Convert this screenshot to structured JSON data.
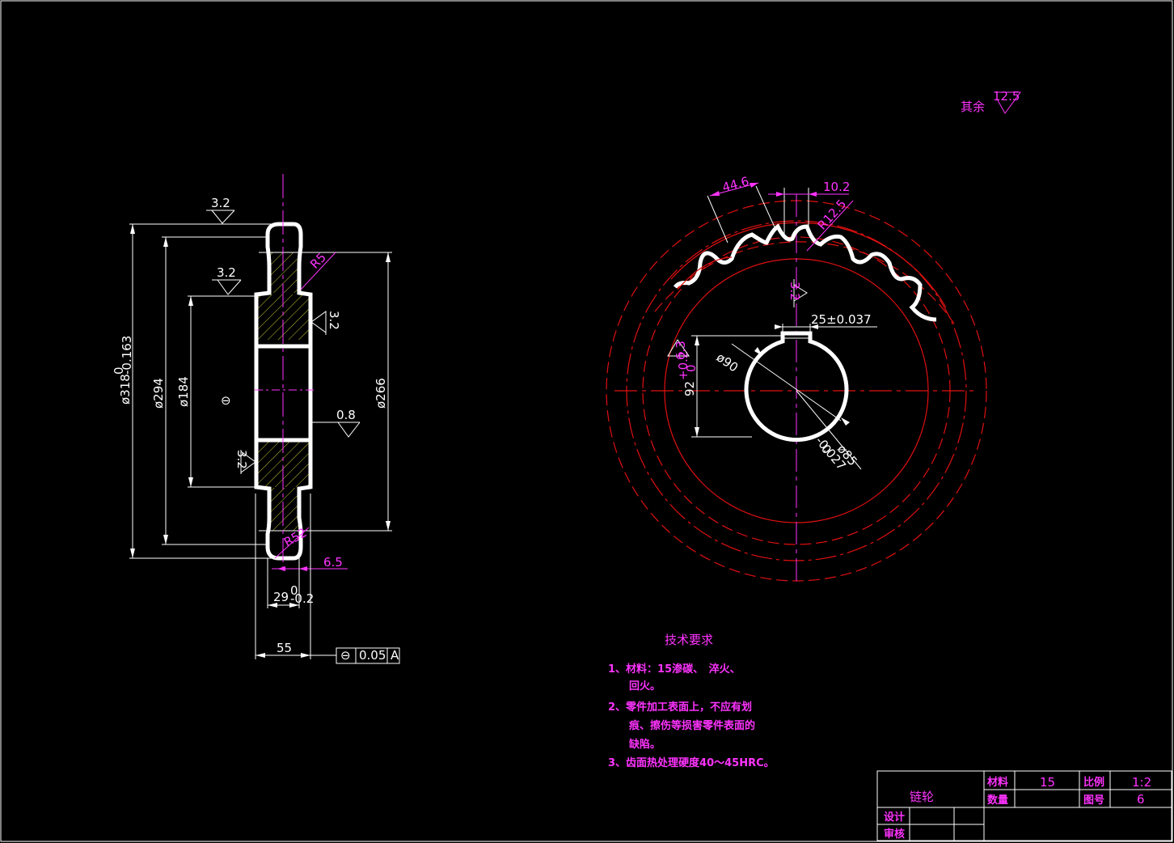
{
  "drawing": {
    "roughness_other": {
      "label": "其余",
      "value": "12.5"
    },
    "side_view": {
      "dimensions": {
        "d318": "ø318",
        "d318_tol_upper": "0",
        "d318_tol_lower": "-0.163",
        "d294": "ø294",
        "d184": "ø184",
        "d266": "ø266",
        "w29": "29",
        "w29_tol_upper": "0",
        "w29_tol_lower": "-0.2",
        "w55": "55",
        "w6_5": "6.5",
        "r5": "R5",
        "r52": "R52"
      },
      "roughness": [
        "3.2",
        "3.2",
        "3.2",
        "0.8",
        "3.2"
      ],
      "flatness_symbol": "⊖",
      "tolerance_frame": {
        "symbol": "⊖",
        "value": "0.05",
        "datum": "A"
      }
    },
    "front_view": {
      "dimensions": {
        "pitch": "44.6",
        "tooth_width": "10.2",
        "root_radius": "R12.5",
        "keyway_width": "25±0.037",
        "keyway_depth": "92",
        "keyway_depth_tol_upper": "+0.2",
        "keyway_depth_tol_lower": "0",
        "bore": "ø90",
        "bore_fit": "ø85",
        "bore_fit_tol_upper": "0",
        "bore_fit_tol_lower": "-0.027"
      },
      "roughness": [
        "3.2",
        "6.3"
      ]
    },
    "tech_requirements": {
      "title": "技术要求",
      "items": [
        "1、材料：15渗碳、　淬火、",
        "　　回火。",
        "2、零件加工表面上，不应有划",
        "　　痕、擦伤等损害零件表面的",
        "　　缺陷。",
        "3、齿面热处理硬度40～45HRC。"
      ]
    },
    "title_block": {
      "part_name": "链轮",
      "material_label": "材料",
      "material_value": "15",
      "scale_label": "比例",
      "scale_value": "1:2",
      "quantity_label": "数量",
      "drawing_no_label": "图号",
      "drawing_no_value": "6",
      "design_label": "设计",
      "review_label": "审核"
    }
  }
}
